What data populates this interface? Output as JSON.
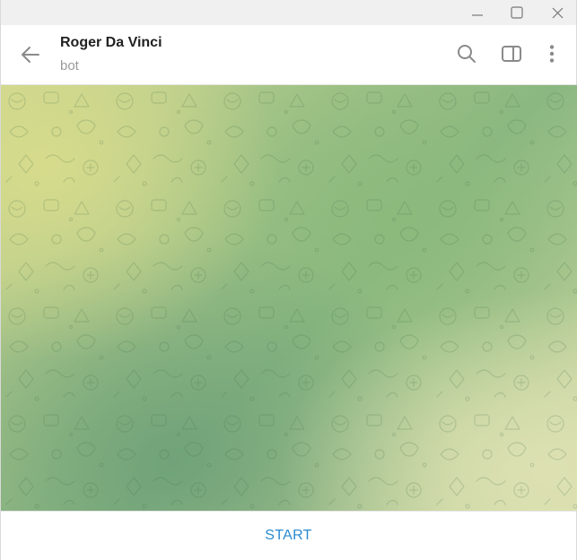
{
  "window": {
    "controls": [
      {
        "name": "minimize",
        "icon": "minimize-icon"
      },
      {
        "name": "maximize",
        "icon": "maximize-icon"
      },
      {
        "name": "close",
        "icon": "close-icon"
      }
    ]
  },
  "header": {
    "title": "Roger Da Vinci",
    "subtitle": "bot",
    "icons": {
      "back": "arrow-left-icon",
      "search": "search-icon",
      "sidebar": "sidebar-panel-icon",
      "more": "more-vertical-icon"
    }
  },
  "chat": {
    "background_colors": [
      "#cbd58f",
      "#8ab782",
      "#6ea078",
      "#d8dcb0"
    ]
  },
  "footer": {
    "start_label": "START",
    "accent_color": "#2a8ad0"
  }
}
